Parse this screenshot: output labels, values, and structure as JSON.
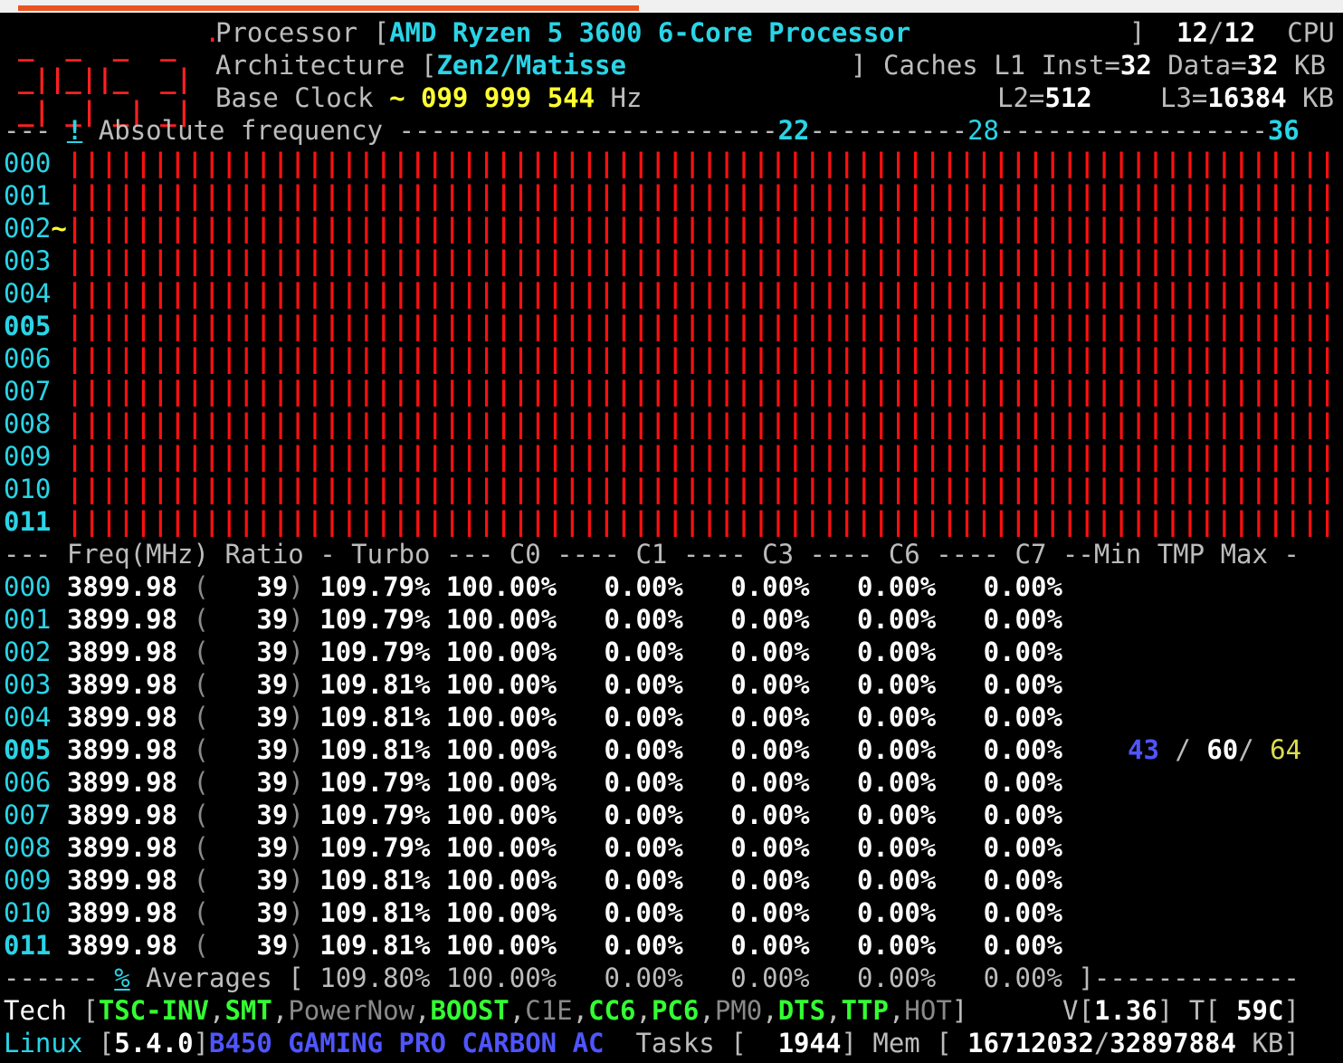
{
  "header": {
    "processor_label": "Processor",
    "processor_name": "AMD Ryzen 5 3600 6-Core Processor",
    "cpu_online": "12",
    "cpu_total": "12",
    "cpu_label": "CPU",
    "architecture_label": "Architecture",
    "architecture": "Zen2/Matisse",
    "caches_label": "Caches L1 Inst=",
    "l1_inst": "32",
    "data_label": "Data=",
    "l1_data": "32",
    "kb": "KB",
    "base_clock_label": "Base Clock",
    "base_clock_tilde": "~",
    "base_clock": "099 999 544",
    "hz": "Hz",
    "l2_label": "L2=",
    "l2": "512",
    "l3_label": "L3=",
    "l3": "16384"
  },
  "freq_graph": {
    "marker": "!",
    "title": "Absolute frequency",
    "scale": [
      "22",
      "28",
      "36"
    ],
    "core_ids": [
      "000",
      "001",
      "002",
      "003",
      "004",
      "005",
      "006",
      "007",
      "008",
      "009",
      "010",
      "011"
    ],
    "active_tilde_core": "~"
  },
  "table": {
    "headers": [
      "Freq(MHz)",
      "Ratio",
      "Turbo",
      "C0",
      "C1",
      "C3",
      "C6",
      "C7",
      "Min",
      "TMP",
      "Max"
    ],
    "rows": [
      {
        "id": "000",
        "freq": "3899.98",
        "ratio": "39",
        "turbo": "109.79%",
        "c0": "100.00%",
        "c1": "0.00%",
        "c3": "0.00%",
        "c6": "0.00%",
        "c7": "0.00%"
      },
      {
        "id": "001",
        "freq": "3899.98",
        "ratio": "39",
        "turbo": "109.79%",
        "c0": "100.00%",
        "c1": "0.00%",
        "c3": "0.00%",
        "c6": "0.00%",
        "c7": "0.00%"
      },
      {
        "id": "002",
        "freq": "3899.98",
        "ratio": "39",
        "turbo": "109.79%",
        "c0": "100.00%",
        "c1": "0.00%",
        "c3": "0.00%",
        "c6": "0.00%",
        "c7": "0.00%"
      },
      {
        "id": "003",
        "freq": "3899.98",
        "ratio": "39",
        "turbo": "109.81%",
        "c0": "100.00%",
        "c1": "0.00%",
        "c3": "0.00%",
        "c6": "0.00%",
        "c7": "0.00%"
      },
      {
        "id": "004",
        "freq": "3899.98",
        "ratio": "39",
        "turbo": "109.81%",
        "c0": "100.00%",
        "c1": "0.00%",
        "c3": "0.00%",
        "c6": "0.00%",
        "c7": "0.00%"
      },
      {
        "id": "005",
        "freq": "3899.98",
        "ratio": "39",
        "turbo": "109.81%",
        "c0": "100.00%",
        "c1": "0.00%",
        "c3": "0.00%",
        "c6": "0.00%",
        "c7": "0.00%"
      },
      {
        "id": "006",
        "freq": "3899.98",
        "ratio": "39",
        "turbo": "109.79%",
        "c0": "100.00%",
        "c1": "0.00%",
        "c3": "0.00%",
        "c6": "0.00%",
        "c7": "0.00%"
      },
      {
        "id": "007",
        "freq": "3899.98",
        "ratio": "39",
        "turbo": "109.79%",
        "c0": "100.00%",
        "c1": "0.00%",
        "c3": "0.00%",
        "c6": "0.00%",
        "c7": "0.00%"
      },
      {
        "id": "008",
        "freq": "3899.98",
        "ratio": "39",
        "turbo": "109.79%",
        "c0": "100.00%",
        "c1": "0.00%",
        "c3": "0.00%",
        "c6": "0.00%",
        "c7": "0.00%"
      },
      {
        "id": "009",
        "freq": "3899.98",
        "ratio": "39",
        "turbo": "109.81%",
        "c0": "100.00%",
        "c1": "0.00%",
        "c3": "0.00%",
        "c6": "0.00%",
        "c7": "0.00%"
      },
      {
        "id": "010",
        "freq": "3899.98",
        "ratio": "39",
        "turbo": "109.81%",
        "c0": "100.00%",
        "c1": "0.00%",
        "c3": "0.00%",
        "c6": "0.00%",
        "c7": "0.00%"
      },
      {
        "id": "011",
        "freq": "3899.98",
        "ratio": "39",
        "turbo": "109.81%",
        "c0": "100.00%",
        "c1": "0.00%",
        "c3": "0.00%",
        "c6": "0.00%",
        "c7": "0.00%"
      }
    ],
    "temp": {
      "min": "43",
      "tmp": "60",
      "max": "64"
    }
  },
  "averages": {
    "marker": "%",
    "label": "Averages",
    "turbo": "109.80%",
    "c0": "100.00%",
    "c1": "0.00%",
    "c3": "0.00%",
    "c6": "0.00%",
    "c7": "0.00%"
  },
  "tech": {
    "label": "Tech",
    "features": [
      {
        "name": "TSC-INV",
        "on": true
      },
      {
        "name": "SMT",
        "on": true
      },
      {
        "name": "PowerNow",
        "on": false
      },
      {
        "name": "BOOST",
        "on": true
      },
      {
        "name": "C1E",
        "on": false
      },
      {
        "name": "CC6",
        "on": true
      },
      {
        "name": "PC6",
        "on": true
      },
      {
        "name": "PM0",
        "on": false
      },
      {
        "name": "DTS",
        "on": true
      },
      {
        "name": "TTP",
        "on": true
      },
      {
        "name": "HOT",
        "on": false
      }
    ],
    "v_label": "V",
    "voltage": "1.36",
    "t_label": "T",
    "temperature": "59C"
  },
  "status": {
    "os": "Linux",
    "kernel": "5.4.0",
    "board": "B450 GAMING PRO CARBON AC",
    "tasks_label": "Tasks",
    "tasks": "1944",
    "mem_label": "Mem",
    "mem_used": "16712032",
    "mem_total": "32897884",
    "mem_unit": "KB"
  },
  "colors": {
    "background": "#000000",
    "accent_cyan": "#2ad4e6",
    "accent_yellow": "#ffff33",
    "bar_red": "#ff1010",
    "feature_on": "#33ff33",
    "board_blue": "#4f55ff",
    "window_accent": "#e95420"
  }
}
